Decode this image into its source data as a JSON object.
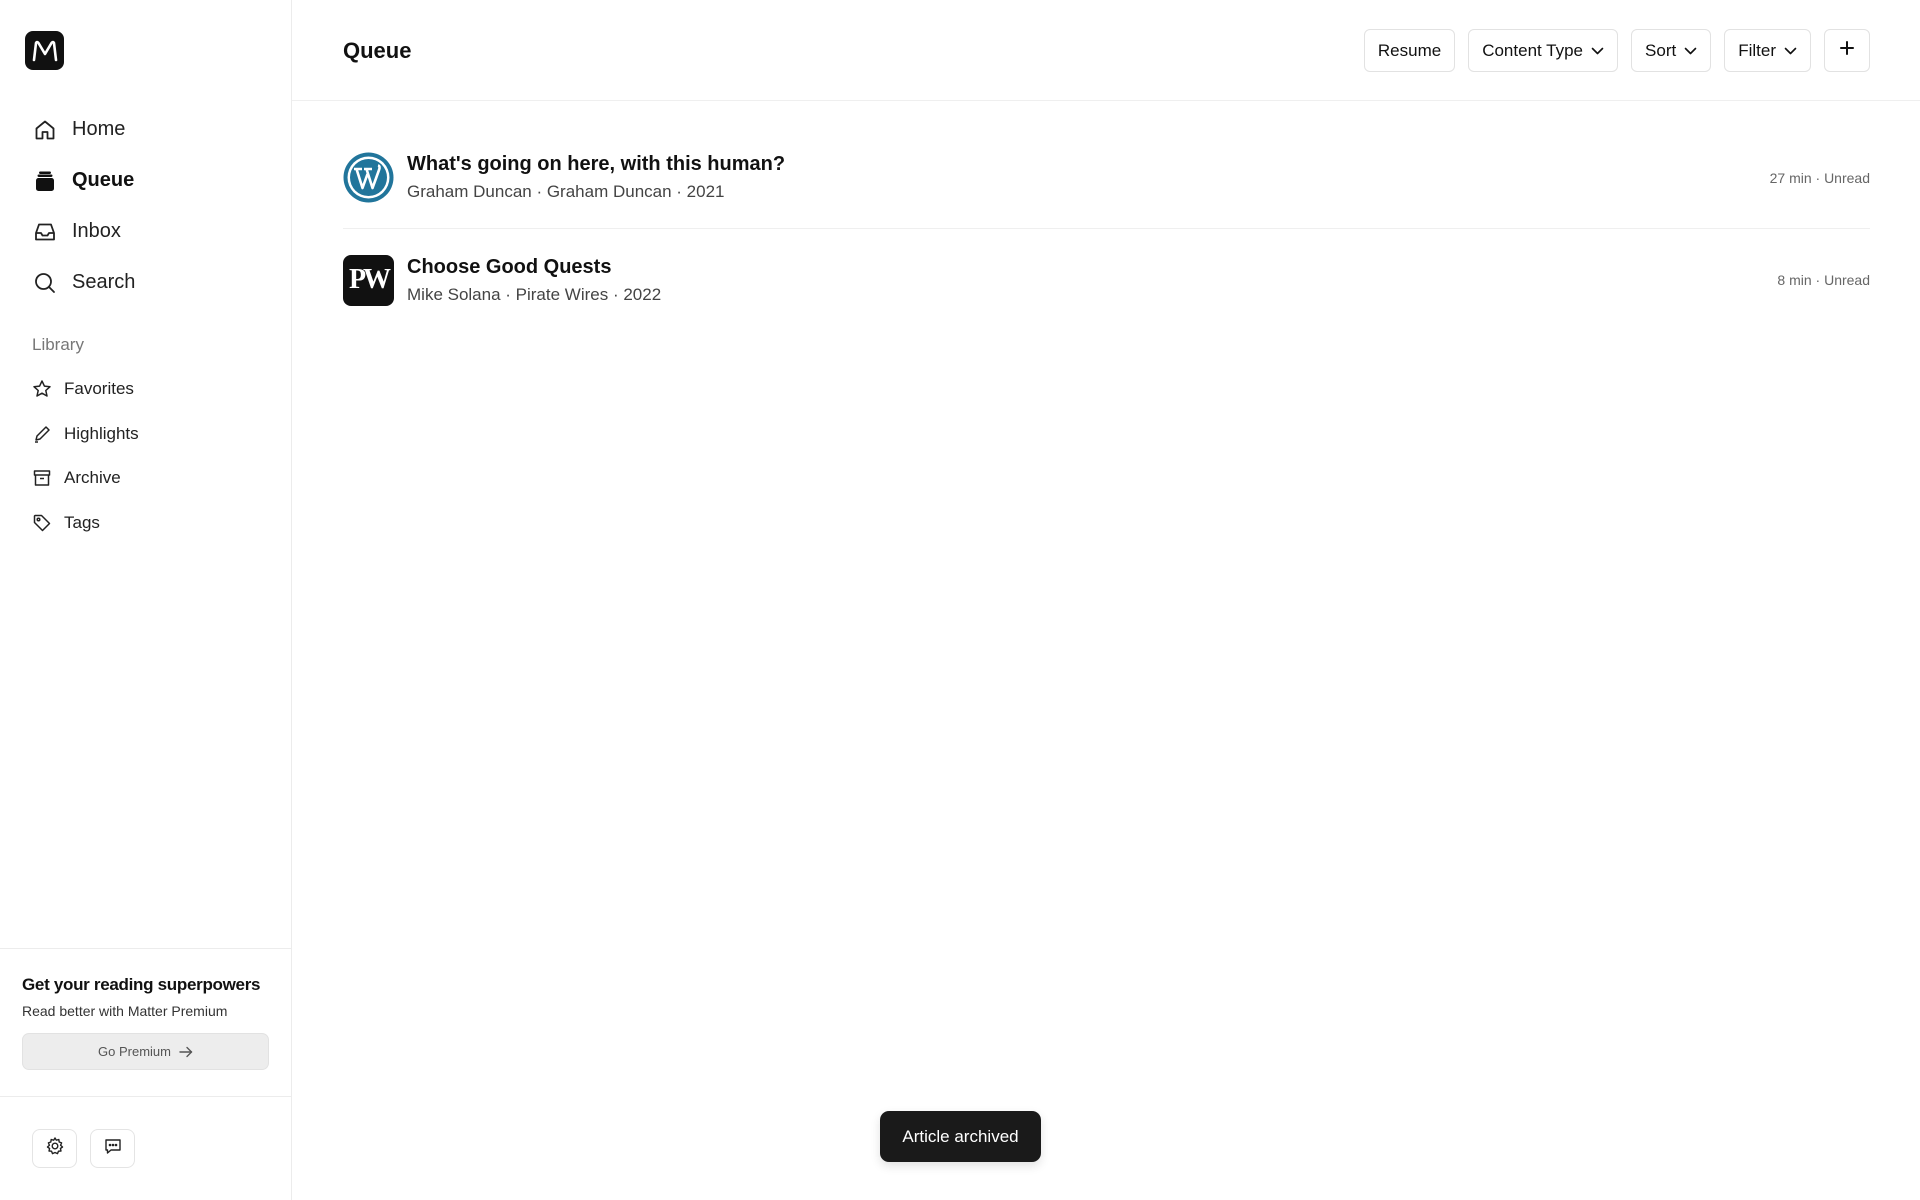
{
  "app": {
    "logo_icon": "matter-logo-icon"
  },
  "nav": {
    "items": [
      {
        "label": "Home",
        "icon": "home-icon"
      },
      {
        "label": "Queue",
        "icon": "queue-stack-icon",
        "active": true
      },
      {
        "label": "Inbox",
        "icon": "inbox-icon"
      },
      {
        "label": "Search",
        "icon": "search-icon"
      }
    ]
  },
  "library": {
    "title": "Library",
    "items": [
      {
        "label": "Favorites",
        "icon": "star-icon"
      },
      {
        "label": "Highlights",
        "icon": "pencil-icon"
      },
      {
        "label": "Archive",
        "icon": "archive-box-icon"
      },
      {
        "label": "Tags",
        "icon": "tag-icon"
      }
    ]
  },
  "promo": {
    "title": "Get your reading superpowers",
    "subtitle": "Read better with Matter Premium",
    "button_label": "Go Premium"
  },
  "footer": {
    "settings_icon": "gear-icon",
    "feedback_icon": "chat-bubble-icon"
  },
  "header": {
    "title": "Queue",
    "resume_label": "Resume",
    "content_type_label": "Content Type",
    "sort_label": "Sort",
    "filter_label": "Filter",
    "add_label": "+"
  },
  "articles": [
    {
      "title": "What's going on here, with this human?",
      "meta": "Graham Duncan · Graham Duncan · 2021",
      "status": "27 min · Unread",
      "source_icon": "wordpress-icon"
    },
    {
      "title": "Choose Good Quests",
      "meta": "Mike Solana · Pirate Wires · 2022",
      "status": "8 min · Unread",
      "source_icon": "pirate-wires-logo",
      "logo_text": "PW"
    }
  ],
  "toast": {
    "message": "Article archived"
  },
  "colors": {
    "text": "#111111",
    "muted": "#666666",
    "border": "#e2e2e2",
    "toast_bg": "#1a1a1a",
    "wordpress_blue": "#21759b"
  }
}
